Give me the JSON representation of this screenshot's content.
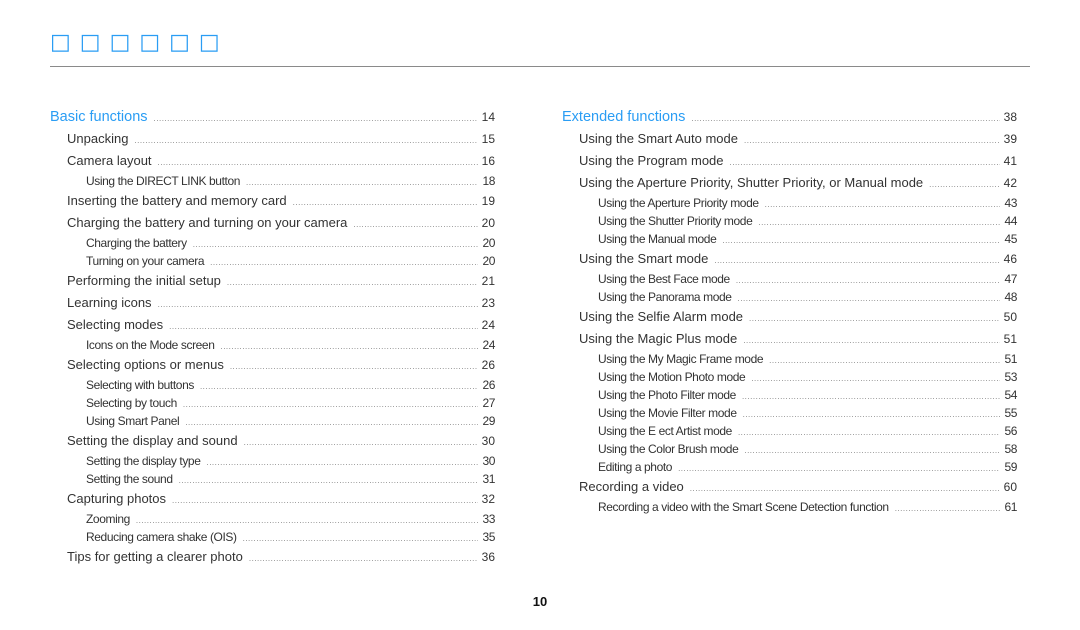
{
  "header": {
    "title": "□□□□□□"
  },
  "toc": {
    "left": [
      {
        "level": 0,
        "label": "Basic functions",
        "page": "14"
      },
      {
        "level": 1,
        "label": "Unpacking",
        "page": "15"
      },
      {
        "level": 1,
        "label": "Camera layout",
        "page": "16"
      },
      {
        "level": 2,
        "label": "Using the DIRECT LINK button",
        "page": "18"
      },
      {
        "level": 1,
        "label": "Inserting the battery and memory card",
        "page": "19"
      },
      {
        "level": 1,
        "label": "Charging the battery and turning on your camera",
        "page": "20"
      },
      {
        "level": 2,
        "label": "Charging the battery",
        "page": "20"
      },
      {
        "level": 2,
        "label": "Turning on your camera",
        "page": "20"
      },
      {
        "level": 1,
        "label": "Performing the initial setup",
        "page": "21"
      },
      {
        "level": 1,
        "label": "Learning icons",
        "page": "23"
      },
      {
        "level": 1,
        "label": "Selecting modes",
        "page": "24"
      },
      {
        "level": 2,
        "label": "Icons on the Mode screen",
        "page": "24"
      },
      {
        "level": 1,
        "label": "Selecting options or menus",
        "page": "26"
      },
      {
        "level": 2,
        "label": "Selecting with buttons",
        "page": "26"
      },
      {
        "level": 2,
        "label": "Selecting by touch",
        "page": "27"
      },
      {
        "level": 2,
        "label": "Using Smart Panel",
        "page": "29"
      },
      {
        "level": 1,
        "label": "Setting the display and sound",
        "page": "30"
      },
      {
        "level": 2,
        "label": "Setting the display type",
        "page": "30"
      },
      {
        "level": 2,
        "label": "Setting the sound",
        "page": "31"
      },
      {
        "level": 1,
        "label": "Capturing photos",
        "page": "32"
      },
      {
        "level": 2,
        "label": "Zooming",
        "page": "33"
      },
      {
        "level": 2,
        "label": "Reducing camera shake (OIS)",
        "page": "35"
      },
      {
        "level": 1,
        "label": "Tips for getting a clearer photo",
        "page": "36"
      }
    ],
    "right": [
      {
        "level": 0,
        "label": "Extended functions",
        "page": "38"
      },
      {
        "level": 1,
        "label": "Using the Smart Auto mode",
        "page": "39"
      },
      {
        "level": 1,
        "label": "Using the Program mode",
        "page": "41"
      },
      {
        "level": 1,
        "label": "Using the Aperture Priority, Shutter Priority, or Manual mode",
        "page": "42"
      },
      {
        "level": 2,
        "label": "Using the Aperture Priority mode",
        "page": "43"
      },
      {
        "level": 2,
        "label": "Using the Shutter Priority mode",
        "page": "44"
      },
      {
        "level": 2,
        "label": "Using the Manual mode",
        "page": "45"
      },
      {
        "level": 1,
        "label": "Using the Smart mode",
        "page": "46"
      },
      {
        "level": 2,
        "label": "Using the Best Face mode",
        "page": "47"
      },
      {
        "level": 2,
        "label": "Using the Panorama mode",
        "page": "48"
      },
      {
        "level": 1,
        "label": "Using the Selfie Alarm mode",
        "page": "50"
      },
      {
        "level": 1,
        "label": "Using the Magic Plus mode",
        "page": "51"
      },
      {
        "level": 2,
        "label": "Using the My Magic Frame mode",
        "page": "51"
      },
      {
        "level": 2,
        "label": "Using the Motion Photo mode",
        "page": "53"
      },
      {
        "level": 2,
        "label": "Using the Photo Filter mode",
        "page": "54"
      },
      {
        "level": 2,
        "label": "Using the Movie Filter mode",
        "page": "55"
      },
      {
        "level": 2,
        "label": "Using the E  ect Artist mode",
        "page": "56"
      },
      {
        "level": 2,
        "label": "Using the Color Brush mode",
        "page": "58"
      },
      {
        "level": 2,
        "label": "Editing a photo",
        "page": "59"
      },
      {
        "level": 1,
        "label": "Recording a video",
        "page": "60"
      },
      {
        "level": 2,
        "label": "Recording a video with the Smart Scene Detection function",
        "page": "61"
      }
    ]
  },
  "footer": {
    "page_number": "10"
  }
}
